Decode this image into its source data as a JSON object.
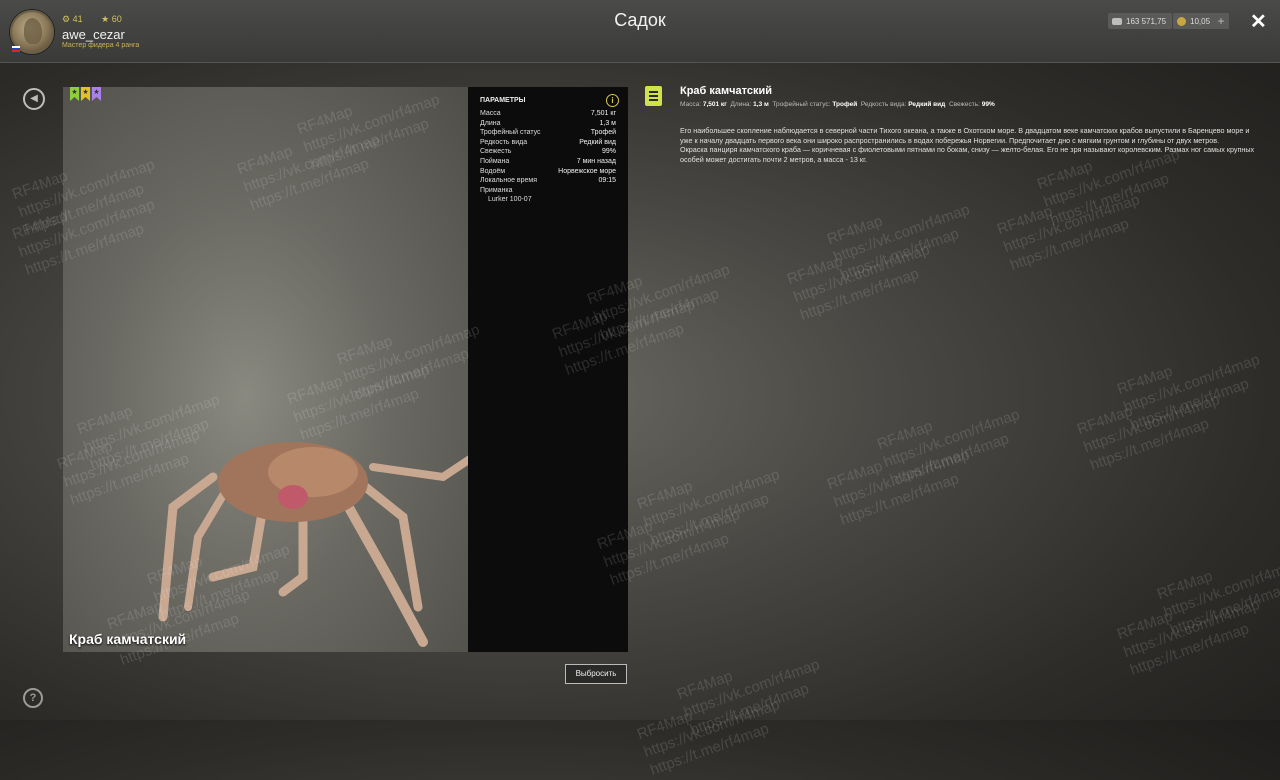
{
  "header": {
    "title": "Садок",
    "player": {
      "name": "awe_cezar",
      "rank": "Мастер фидера 4 ранга",
      "level": "41",
      "stars": "60"
    },
    "currency": {
      "silver": "163 571,75",
      "gold": "10,05"
    },
    "plus": "+",
    "close": "✕"
  },
  "card": {
    "fish_name": "Краб камчатский",
    "ribbon_colors": [
      "#8fcf3c",
      "#e1c22a",
      "#a981e8"
    ],
    "params": {
      "title": "ПАРАМЕТРЫ",
      "rows": [
        {
          "label": "Масса",
          "value": "7,501 кг"
        },
        {
          "label": "Длина",
          "value": "1,3 м"
        },
        {
          "label": "Трофейный статус",
          "value": "Трофей"
        },
        {
          "label": "Редкость вида",
          "value": "Редкий вид"
        },
        {
          "label": "Свежесть",
          "value": "99%"
        },
        {
          "label": "Поймана",
          "value": "7 мин назад"
        },
        {
          "label": "Водоём",
          "value": "Норвежское море"
        },
        {
          "label": "Локальное время",
          "value": "09:15"
        }
      ],
      "bait_label": "Приманка",
      "bait_value": "Lurker 100-07"
    },
    "info_icon": "i"
  },
  "release_button": "Выбросить",
  "description": {
    "title": "Краб камчатский",
    "meta": {
      "mass_label": "Масса:",
      "mass": "7,501 кг",
      "length_label": "Длина:",
      "length": "1,3 м",
      "trophy_label": "Трофейный статус:",
      "trophy": "Трофей",
      "rarity_label": "Редкость вида:",
      "rarity": "Редкий вид",
      "fresh_label": "Свежесть:",
      "fresh": "99%"
    },
    "paragraphs": [
      "Его наибольшее скопление наблюдается в северной части Тихого океана, а также в Охотском море. В двадцатом веке камчатских крабов выпустили в Баренцево море и уже к началу двадцать первого века они широко распространились в водах побережья Норвегии. Предпочитает дно с мягким грунтом и глубины от двух метров.",
      "Окраска панциря камчатского краба — коричневая с фиолетовыми пятнами по бокам, снизу — желто-белая. Его не зря называют королевским. Размах ног самых крупных особей может достигать почти 2 метров, а масса - 13 кг."
    ]
  },
  "side": {
    "back": "◀",
    "help": "?"
  },
  "watermark": [
    "RF4Map",
    "https://vk.com/rf4map",
    "https://t.me/rf4map"
  ]
}
